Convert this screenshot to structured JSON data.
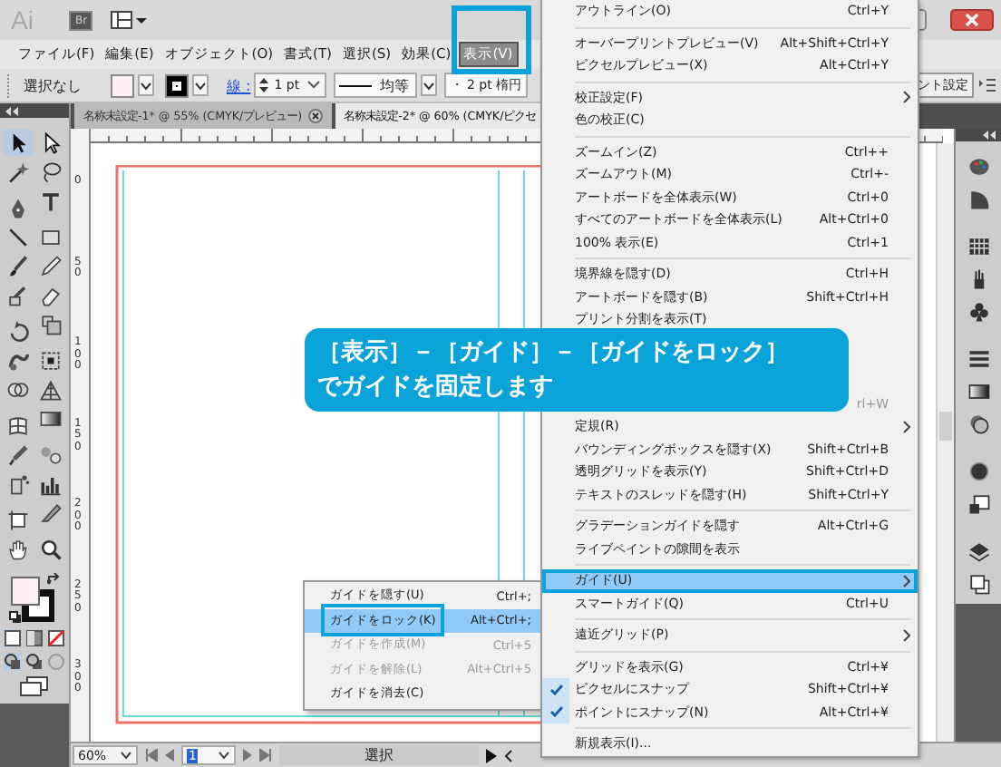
{
  "app_bar": {
    "logo": "Ai",
    "bridge": "Br"
  },
  "menu_bar": [
    {
      "label": "ファイル(F)",
      "selected": false
    },
    {
      "label": "編集(E)",
      "selected": false
    },
    {
      "label": "オブジェクト(O)",
      "selected": false
    },
    {
      "label": "書式(T)",
      "selected": false
    },
    {
      "label": "選択(S)",
      "selected": false
    },
    {
      "label": "効果(C)",
      "selected": false
    },
    {
      "label": "表示(V)",
      "selected": true
    }
  ],
  "annotation_frames": {
    "view_menu_title": true,
    "lock_item": true
  },
  "control_bar": {
    "selection": "選択なし",
    "stroke_label": "線 :",
    "stroke_weight": "1 pt",
    "profile": "均等",
    "brush": "・ 2 pt 楕円",
    "right_button": "ント設定"
  },
  "doc_tabs": [
    {
      "title": "名称未設定-1* @ 55% (CMYK/プレビュー)",
      "selected": false,
      "closable": true
    },
    {
      "title": "名称未設定-2* @ 60% (CMYK/ピクセ",
      "selected": true,
      "closable": false
    }
  ],
  "ruler_labels": [
    "0",
    "50",
    "100",
    "150",
    "200",
    "250",
    "300"
  ],
  "view_menu": {
    "items": [
      {
        "kind": "item",
        "label": "アウトライン(O)",
        "shortcut": "Ctrl+Y",
        "submenu": false,
        "checked": false,
        "selected": false,
        "framed": false
      },
      {
        "kind": "separator"
      },
      {
        "kind": "item",
        "label": "オーバープリントプレビュー(V)",
        "shortcut": "Alt+Shift+Ctrl+Y",
        "submenu": false,
        "checked": false,
        "selected": false,
        "framed": false
      },
      {
        "kind": "item",
        "label": "ピクセルプレビュー(X)",
        "shortcut": "Alt+Ctrl+Y",
        "submenu": false,
        "checked": false,
        "selected": false,
        "framed": false
      },
      {
        "kind": "separator"
      },
      {
        "kind": "item",
        "label": "校正設定(F)",
        "submenu": true,
        "checked": false,
        "selected": false,
        "framed": false
      },
      {
        "kind": "item",
        "label": "色の校正(C)",
        "submenu": false,
        "checked": false,
        "selected": false,
        "framed": false
      },
      {
        "kind": "separator"
      },
      {
        "kind": "item",
        "label": "ズームイン(Z)",
        "shortcut": "Ctrl++",
        "submenu": false,
        "checked": false,
        "selected": false,
        "framed": false
      },
      {
        "kind": "item",
        "label": "ズームアウト(M)",
        "shortcut": "Ctrl+-",
        "submenu": false,
        "checked": false,
        "selected": false,
        "framed": false
      },
      {
        "kind": "item",
        "label": "アートボードを全体表示(W)",
        "shortcut": "Ctrl+0",
        "submenu": false,
        "checked": false,
        "selected": false,
        "framed": false
      },
      {
        "kind": "item",
        "label": "すべてのアートボードを全体表示(L)",
        "shortcut": "Alt+Ctrl+0",
        "submenu": false,
        "checked": false,
        "selected": false,
        "framed": false
      },
      {
        "kind": "item",
        "label": "100% 表示(E)",
        "shortcut": "Ctrl+1",
        "submenu": false,
        "checked": false,
        "selected": false,
        "framed": false
      },
      {
        "kind": "separator"
      },
      {
        "kind": "item",
        "label": "境界線を隠す(D)",
        "shortcut": "Ctrl+H",
        "submenu": false,
        "checked": false,
        "selected": false,
        "framed": false
      },
      {
        "kind": "item",
        "label": "アートボードを隠す(B)",
        "shortcut": "Shift+Ctrl+H",
        "submenu": false,
        "checked": false,
        "selected": false,
        "framed": false
      },
      {
        "kind": "item",
        "label": "プリント分割を表示(T)",
        "submenu": false,
        "checked": false,
        "selected": false,
        "framed": false
      },
      {
        "kind": "partial",
        "shortcut": "rl+W"
      },
      {
        "kind": "item",
        "label": "定規(R)",
        "submenu": true,
        "checked": false,
        "selected": false,
        "framed": false
      },
      {
        "kind": "item",
        "label": "バウンディングボックスを隠す(X)",
        "shortcut": "Shift+Ctrl+B",
        "submenu": false,
        "checked": false,
        "selected": false,
        "framed": false
      },
      {
        "kind": "item",
        "label": "透明グリッドを表示(Y)",
        "shortcut": "Shift+Ctrl+D",
        "submenu": false,
        "checked": false,
        "selected": false,
        "framed": false
      },
      {
        "kind": "item",
        "label": "テキストのスレッドを隠す(H)",
        "shortcut": "Shift+Ctrl+Y",
        "submenu": false,
        "checked": false,
        "selected": false,
        "framed": false
      },
      {
        "kind": "separator"
      },
      {
        "kind": "item",
        "label": "グラデーションガイドを隠す",
        "shortcut": "Alt+Ctrl+G",
        "submenu": false,
        "checked": false,
        "selected": false,
        "framed": false
      },
      {
        "kind": "item",
        "label": "ライブペイントの隙間を表示",
        "submenu": false,
        "checked": false,
        "selected": false,
        "framed": false
      },
      {
        "kind": "separator"
      },
      {
        "kind": "item",
        "label": "ガイド(U)",
        "submenu": true,
        "checked": false,
        "selected": true,
        "framed": true
      },
      {
        "kind": "item",
        "label": "スマートガイド(Q)",
        "shortcut": "Ctrl+U",
        "submenu": false,
        "checked": false,
        "selected": false,
        "framed": false
      },
      {
        "kind": "separator"
      },
      {
        "kind": "item",
        "label": "遠近グリッド(P)",
        "submenu": true,
        "checked": false,
        "selected": false,
        "framed": false
      },
      {
        "kind": "separator"
      },
      {
        "kind": "item",
        "label": "グリッドを表示(G)",
        "shortcut": "Ctrl+¥",
        "submenu": false,
        "checked": false,
        "selected": false,
        "framed": false
      },
      {
        "kind": "item",
        "label": "ピクセルにスナップ",
        "shortcut": "Shift+Ctrl+¥",
        "submenu": false,
        "checked": true,
        "selected": false,
        "framed": false
      },
      {
        "kind": "item",
        "label": "ポイントにスナップ(N)",
        "shortcut": "Alt+Ctrl+¥",
        "submenu": false,
        "checked": true,
        "selected": false,
        "framed": false
      },
      {
        "kind": "separator"
      },
      {
        "kind": "item",
        "label": "新規表示(I)...",
        "submenu": false,
        "checked": false,
        "selected": false,
        "framed": false
      }
    ]
  },
  "guide_submenu": {
    "items": [
      {
        "label": "ガイドを隠す(U)",
        "shortcut": "Ctrl+;",
        "disabled": false,
        "selected": false
      },
      {
        "label": "ガイドをロック(K)",
        "shortcut": "Alt+Ctrl+;",
        "disabled": false,
        "selected": true
      },
      {
        "label": "ガイドを作成(M)",
        "shortcut": "Ctrl+5",
        "disabled": true,
        "selected": false
      },
      {
        "label": "ガイドを解除(L)",
        "shortcut": "Alt+Ctrl+5",
        "disabled": true,
        "selected": false
      },
      {
        "label": "ガイドを消去(C)",
        "disabled": false,
        "selected": false
      }
    ]
  },
  "callout": {
    "lines": [
      "［表示］－［ガイド］－［ガイドをロック］",
      "でガイドを固定します"
    ]
  },
  "status_bar": {
    "zoom": "60%",
    "artboard": "1",
    "tool": "選択"
  }
}
